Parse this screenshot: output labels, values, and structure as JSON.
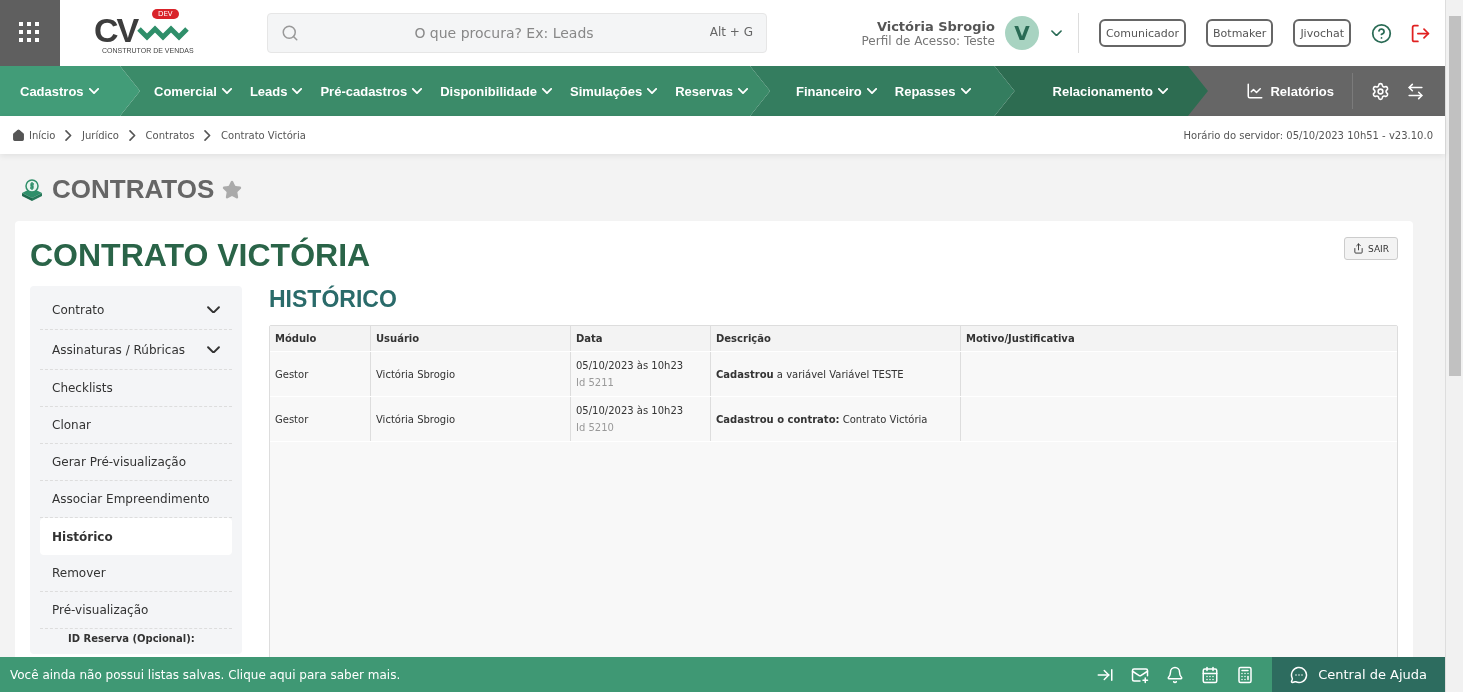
{
  "header": {
    "logo": {
      "letters": "CV",
      "badge": "DEV",
      "tagline": "CONSTRUTOR DE VENDAS"
    },
    "search": {
      "placeholder": "O que procura? Ex: Leads",
      "shortcut": "Alt + G"
    },
    "user": {
      "name": "Victória Sbrogio",
      "profile": "Perfil de Acesso: Teste",
      "initial": "V"
    },
    "buttons": [
      "Comunicador",
      "Botmaker",
      "Jivochat"
    ]
  },
  "nav": {
    "groups": [
      {
        "color": "#429c78",
        "items": [
          "Cadastros"
        ]
      },
      {
        "color": "#3b8b69",
        "items": [
          "Comercial",
          "Leads",
          "Pré-cadastros",
          "Disponibilidade",
          "Simulações",
          "Reservas"
        ]
      },
      {
        "color": "#347d5f",
        "items": [
          "Financeiro",
          "Repasses"
        ]
      },
      {
        "color": "#2d6c51",
        "items": [
          "Relacionamento"
        ]
      }
    ],
    "reports": "Relatórios"
  },
  "breadcrumb": {
    "items": [
      "Início",
      "Jurídico",
      "Contratos",
      "Contrato Victória"
    ],
    "server_time": "Horário do servidor: 05/10/2023 10h51 - v23.10.0"
  },
  "page_title": "CONTRATOS",
  "card": {
    "title": "CONTRATO VICTÓRIA",
    "exit_button": "SAIR",
    "sidebar": [
      {
        "label": "Contrato",
        "kind": "expandable",
        "selected": false
      },
      {
        "label": "Assinaturas / Rúbricas",
        "kind": "expandable",
        "selected": false
      },
      {
        "label": "Checklists",
        "kind": "link",
        "selected": false
      },
      {
        "label": "Clonar",
        "kind": "link",
        "selected": false
      },
      {
        "label": "Gerar Pré-visualização",
        "kind": "link",
        "selected": false
      },
      {
        "label": "Associar Empreendimento",
        "kind": "link",
        "selected": false
      },
      {
        "label": "Histórico",
        "kind": "link",
        "selected": true
      },
      {
        "label": "Remover",
        "kind": "link",
        "selected": false
      },
      {
        "label": "Pré-visualização",
        "kind": "link",
        "selected": false
      }
    ],
    "sidebar_field_label": "ID Reserva (Opcional):",
    "section_title": "HISTÓRICO",
    "table": {
      "columns": [
        "Módulo",
        "Usuário",
        "Data",
        "Descrição",
        "Motivo/Justificativa"
      ],
      "rows": [
        {
          "module": "Gestor",
          "user": "Victória Sbrogio",
          "date": "05/10/2023 às 10h23",
          "id": "Id 5211",
          "description": "**Cadastrou** a variável Variável TESTE"
        },
        {
          "module": "Gestor",
          "user": "Victória Sbrogio",
          "date": "05/10/2023 às 10h23",
          "id": "Id 5210",
          "description": "**Cadastrou o contrato:** Contrato Victória"
        }
      ]
    }
  },
  "footer": {
    "message": "Você ainda não possui listas salvas. Clique aqui para saber mais.",
    "help": "Central de Ajuda"
  }
}
